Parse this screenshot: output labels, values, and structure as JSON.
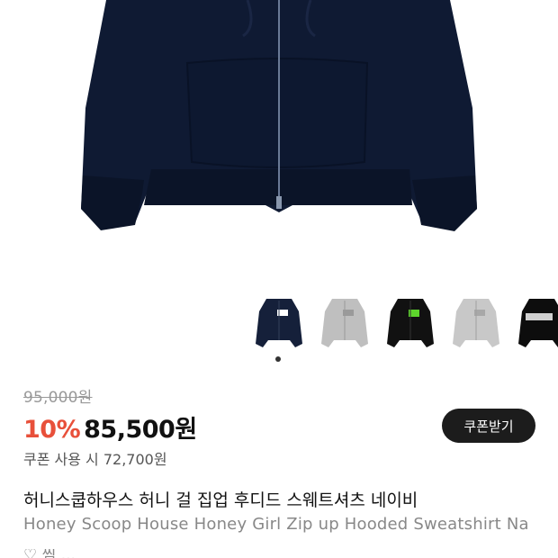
{
  "product": {
    "image_label": "Navy zip-up hoodie",
    "original_price": "95,000원",
    "discount": "10%",
    "sale_price": "85,500원",
    "coupon_button": "쿠폰받기",
    "coupon_price": "쿠폰 사용 시 72,700원",
    "title_ko": "허니스쿱하우스 허니 걸 집업 후디드 스웨트셔츠 네이비",
    "title_en": "Honey Scoop House Honey Girl Zip up Hooded Sweatshirt Na",
    "cutoff_text": "♡ 찜 ..."
  },
  "thumbnails": [
    {
      "name": "navy",
      "color": "#15203a",
      "print": "#ffffff"
    },
    {
      "name": "grey",
      "color": "#bfbfbf",
      "print": "#9a9a9a"
    },
    {
      "name": "black-green",
      "color": "#111111",
      "print": "#5dd62c"
    },
    {
      "name": "light-grey",
      "color": "#c8c8c8",
      "print": "#a8a8a8"
    },
    {
      "name": "black",
      "color": "#0d0d0d",
      "print": "#cfcfcf"
    }
  ],
  "colors": {
    "accent": "#e8503a",
    "button_bg": "#1c1c1c",
    "hoodie": "#0f1a33"
  }
}
